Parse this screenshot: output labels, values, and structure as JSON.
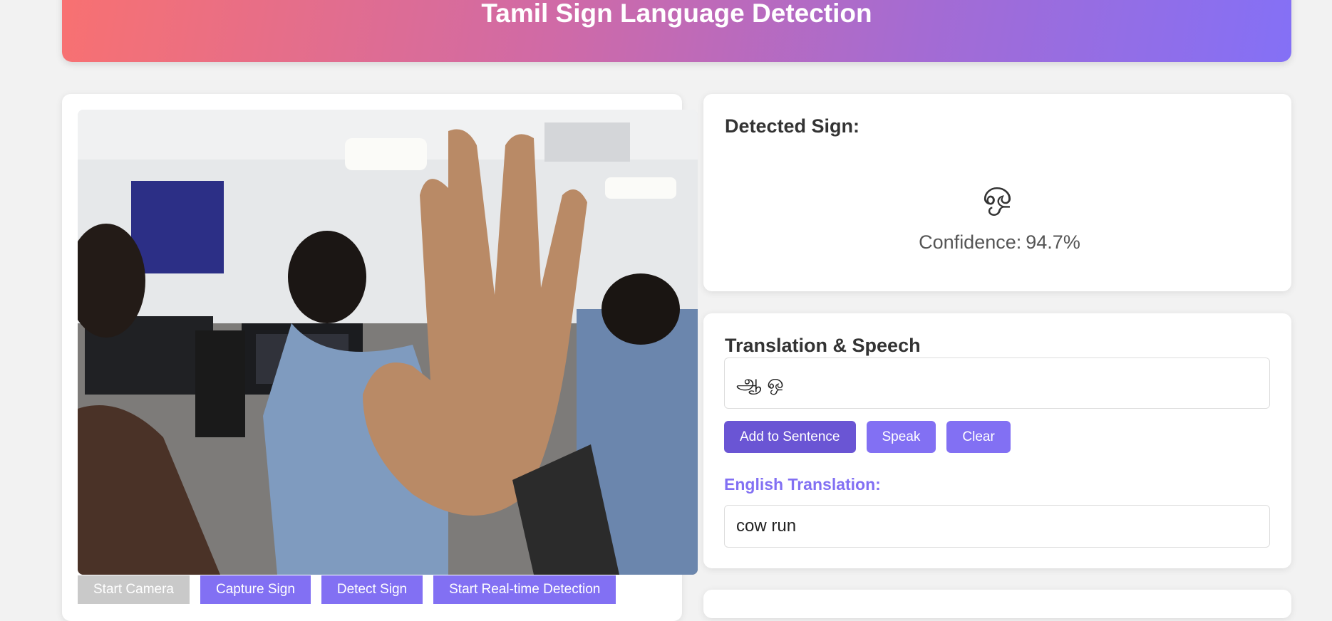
{
  "header": {
    "title": "Tamil Sign Language Detection"
  },
  "camera": {
    "buttons": {
      "start_camera": "Start Camera",
      "capture_sign": "Capture Sign",
      "detect_sign": "Detect Sign",
      "start_realtime": "Start Real-time Detection"
    }
  },
  "detection": {
    "title": "Detected Sign:",
    "sign": "ஒ",
    "confidence_label": "Confidence:",
    "confidence_value": "94.7%"
  },
  "translation": {
    "title": "Translation & Speech",
    "sentence": "ஆ ஒ",
    "buttons": {
      "add": "Add to Sentence",
      "speak": "Speak",
      "clear": "Clear"
    },
    "english_label": "English Translation:",
    "english_text": "cow run"
  },
  "colors": {
    "accent": "#8270f3",
    "accent_dark": "#6a55d4",
    "disabled": "#c9c9c9"
  }
}
